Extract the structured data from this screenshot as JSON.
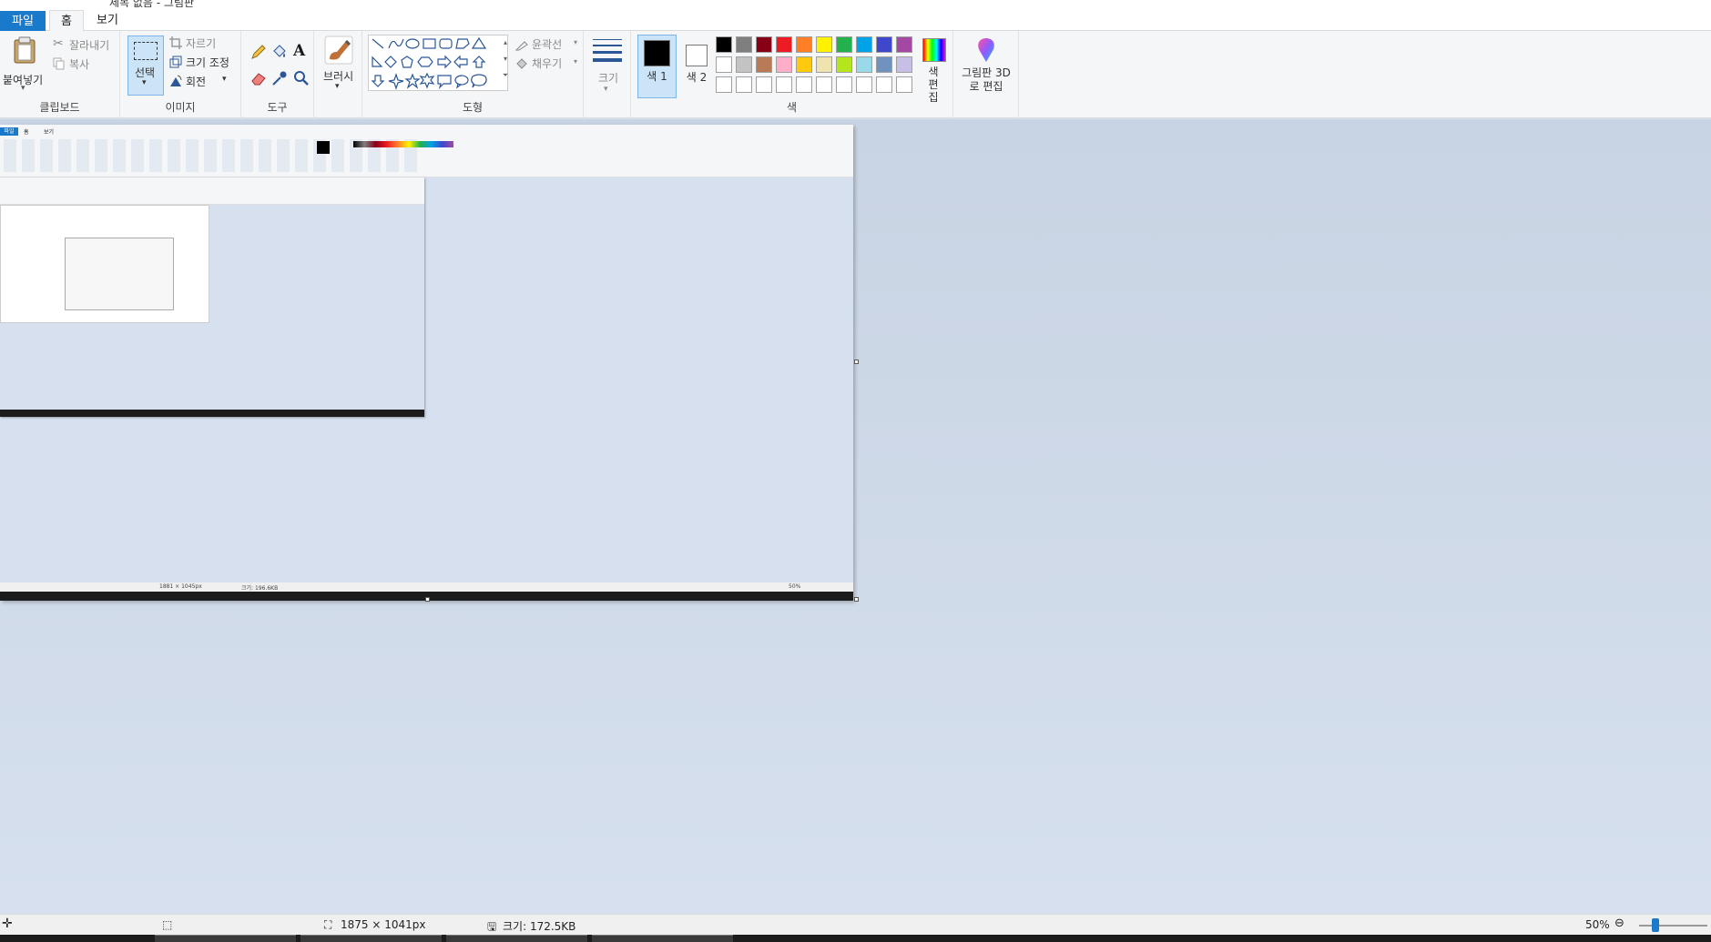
{
  "window": {
    "title": "제목 없음 - 그림판"
  },
  "menu": {
    "tabs": [
      "파일",
      "홈",
      "보기"
    ]
  },
  "ribbon": {
    "clipboard": {
      "paste": "붙여넣기",
      "cut": "잘라내기",
      "copy": "복사",
      "label": "클립보드"
    },
    "image": {
      "select": "선택",
      "crop": "자르기",
      "resize": "크기 조정",
      "rotate": "회전",
      "label": "이미지"
    },
    "tools": {
      "label": "도구"
    },
    "brushes": {
      "label": "브러시"
    },
    "shapes": {
      "outline": "윤곽선",
      "fill": "채우기",
      "label": "도형"
    },
    "size": {
      "label": "크기"
    },
    "colors": {
      "color1": "색 1",
      "color2": "색 2",
      "edit": "색 편집",
      "label": "색",
      "row1": [
        "#000000",
        "#7f7f7f",
        "#880015",
        "#ed1c24",
        "#ff7f27",
        "#fff200",
        "#22b14c",
        "#00a2e8",
        "#3f48cc",
        "#a349a4"
      ],
      "row2": [
        "#ffffff",
        "#c3c3c3",
        "#b97a57",
        "#ffaec9",
        "#ffc90e",
        "#efe4b0",
        "#b5e61d",
        "#99d9ea",
        "#7092be",
        "#c8bfe7"
      ]
    },
    "paint3d": {
      "label": "그림판 3D로 편집"
    }
  },
  "status": {
    "dimensions": "1875 × 1041px",
    "size": "크기: 172.5KB",
    "zoom": "50%"
  },
  "mini": {
    "tabs": [
      "파일",
      "홈",
      "보기"
    ],
    "dimensions": "1881 × 1045px",
    "size": "크기: 196.6KB",
    "zoom": "50%"
  }
}
